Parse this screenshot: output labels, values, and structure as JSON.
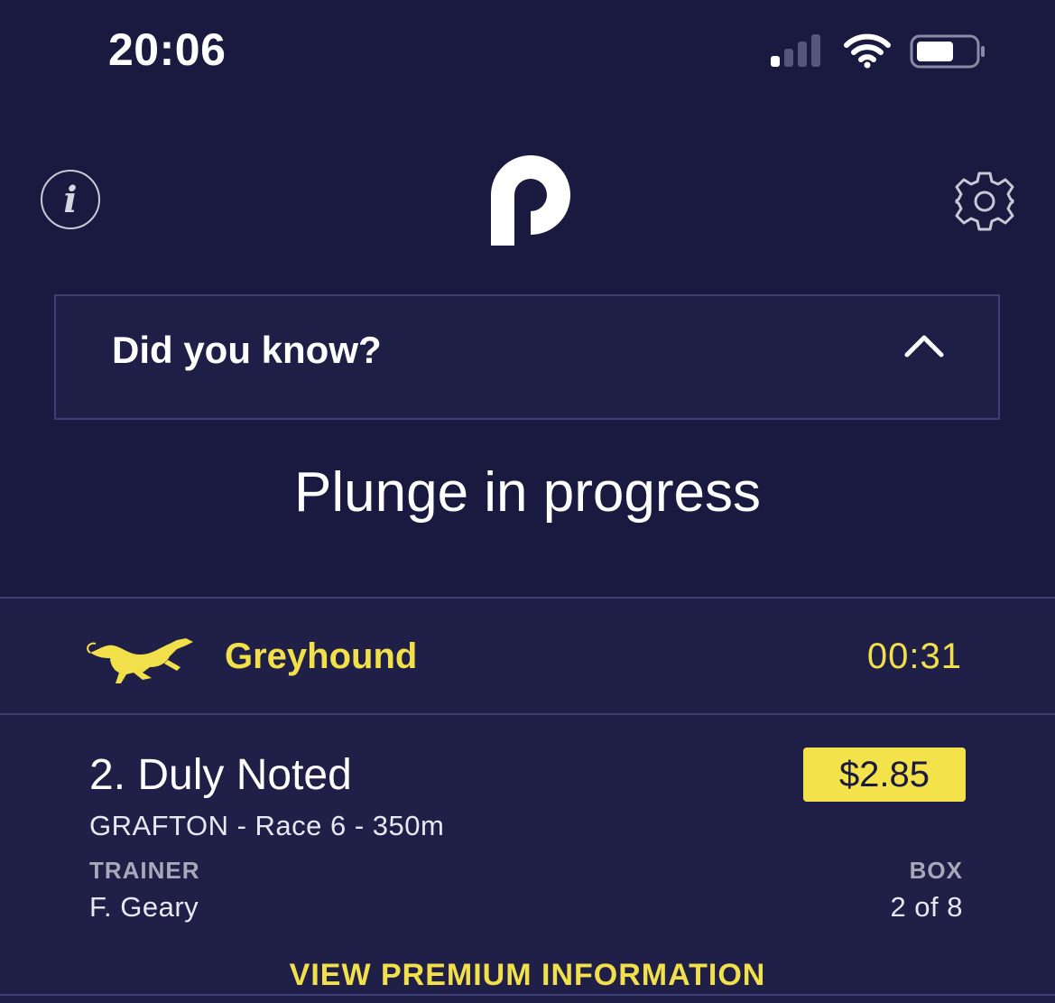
{
  "status_bar": {
    "time": "20:06",
    "signal_icon": "signal-bars-icon",
    "wifi_icon": "wifi-icon",
    "battery_icon": "battery-icon"
  },
  "header": {
    "info_icon": "info-icon",
    "info_glyph": "i",
    "logo_icon": "p-logo-icon",
    "settings_icon": "gear-icon"
  },
  "did_you_know": {
    "title": "Did you know?",
    "chevron_icon": "chevron-up-icon"
  },
  "headline": "Plunge in progress",
  "race_card": {
    "category_icon": "greyhound-icon",
    "category": "Greyhound",
    "countdown": "00:31",
    "runner": "2. Duly Noted",
    "odds": "$2.85",
    "race_info": "GRAFTON - Race 6 - 350m",
    "trainer_label": "TRAINER",
    "trainer": "F. Geary",
    "box_label": "BOX",
    "box": "2 of 8",
    "premium_link": "VIEW PREMIUM INFORMATION"
  },
  "colors": {
    "background": "#1a1940",
    "card": "#1f1f47",
    "accent_yellow": "#f2e04a",
    "border": "#3e3f78"
  }
}
